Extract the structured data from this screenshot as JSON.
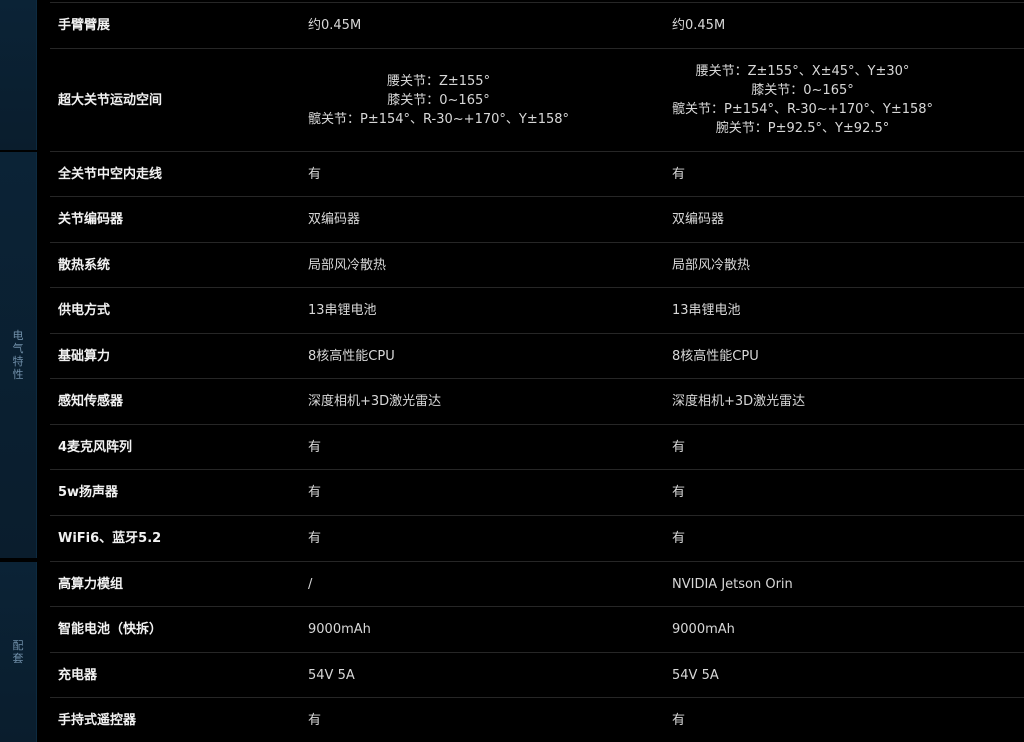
{
  "categories": [
    {
      "id": "top",
      "chars": []
    },
    {
      "id": "electrical",
      "chars": [
        "电",
        "气",
        "特",
        "性"
      ]
    },
    {
      "id": "accessories",
      "chars": [
        "配",
        "套"
      ]
    }
  ],
  "rows": [
    {
      "name": "手臂臂展",
      "col_a": [
        "约0.45M"
      ],
      "col_b": [
        "约0.45M"
      ]
    },
    {
      "name": "超大关节运动空间",
      "col_a": [
        "腰关节：Z±155°",
        "膝关节：0~165°",
        "髋关节：P±154°、R-30~+170°、Y±158°"
      ],
      "col_b": [
        "腰关节：Z±155°、X±45°、Y±30°",
        "膝关节：0~165°",
        "髋关节：P±154°、R-30~+170°、Y±158°",
        "腕关节：P±92.5°、Y±92.5°"
      ]
    },
    {
      "name": "全关节中空内走线",
      "col_a": [
        "有"
      ],
      "col_b": [
        "有"
      ]
    },
    {
      "name": "关节编码器",
      "col_a": [
        "双编码器"
      ],
      "col_b": [
        "双编码器"
      ]
    },
    {
      "name": "散热系统",
      "col_a": [
        "局部风冷散热"
      ],
      "col_b": [
        "局部风冷散热"
      ]
    },
    {
      "name": "供电方式",
      "col_a": [
        "13串锂电池"
      ],
      "col_b": [
        "13串锂电池"
      ]
    },
    {
      "name": "基础算力",
      "col_a": [
        "8核高性能CPU"
      ],
      "col_b": [
        "8核高性能CPU"
      ]
    },
    {
      "name": "感知传感器",
      "col_a": [
        "深度相机+3D激光雷达"
      ],
      "col_b": [
        "深度相机+3D激光雷达"
      ]
    },
    {
      "name": "4麦克风阵列",
      "col_a": [
        "有"
      ],
      "col_b": [
        "有"
      ]
    },
    {
      "name": "5w扬声器",
      "col_a": [
        "有"
      ],
      "col_b": [
        "有"
      ]
    },
    {
      "name": "WiFi6、蓝牙5.2",
      "col_a": [
        "有"
      ],
      "col_b": [
        "有"
      ]
    },
    {
      "name": "高算力模组",
      "col_a": [
        "/"
      ],
      "col_b": [
        "NVIDIA Jetson Orin"
      ]
    },
    {
      "name": "智能电池（快拆）",
      "col_a": [
        "9000mAh"
      ],
      "col_b": [
        "9000mAh"
      ]
    },
    {
      "name": "充电器",
      "col_a": [
        "54V 5A"
      ],
      "col_b": [
        "54V 5A"
      ]
    },
    {
      "name": "手持式遥控器",
      "col_a": [
        "有"
      ],
      "col_b": [
        "有"
      ]
    }
  ]
}
